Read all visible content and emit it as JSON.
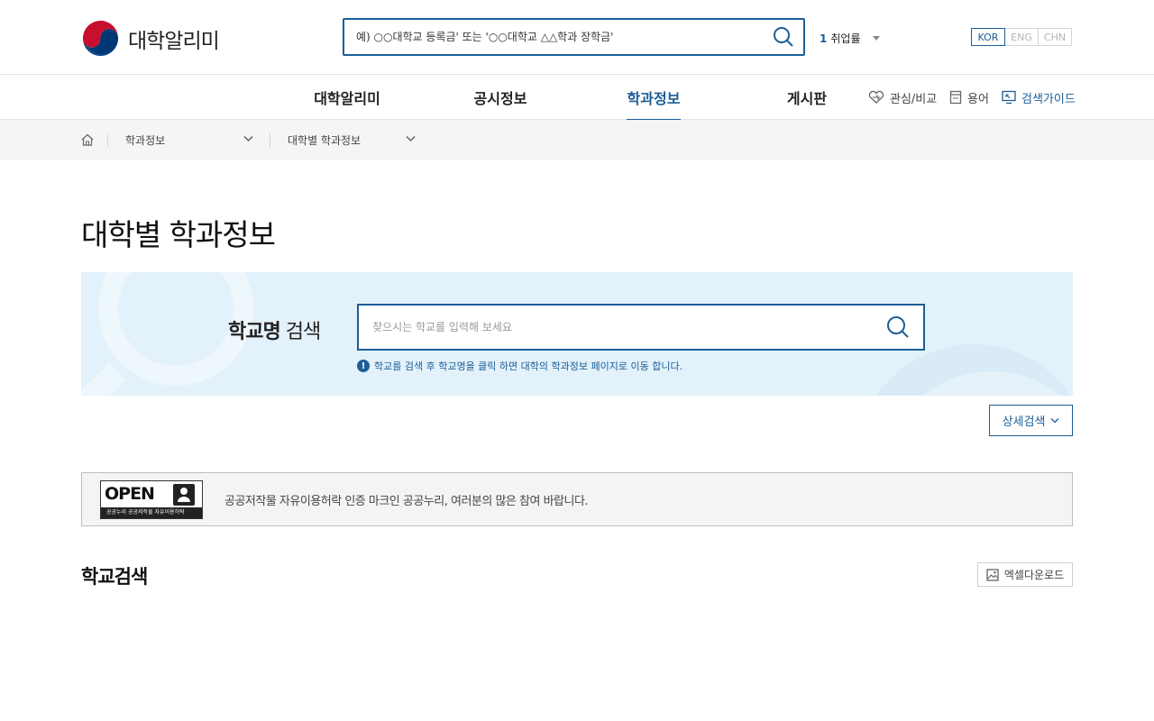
{
  "header": {
    "logo_text": "대학알리미",
    "search_placeholder": "예) ○○대학교 등록금' 또는 '○○대학교 △△학과 장학금'",
    "rank_number": "1",
    "rank_text": "취업률",
    "languages": [
      "KOR",
      "ENG",
      "CHN"
    ],
    "active_language": "KOR"
  },
  "gnb": {
    "items": [
      "대학알리미",
      "공시정보",
      "학과정보",
      "게시판"
    ],
    "active": "학과정보",
    "utils": {
      "favorites": "관심/비교",
      "glossary": "용어",
      "guide": "검색가이드"
    }
  },
  "breadcrumb": {
    "level1": "학과정보",
    "level2": "대학별 학과정보"
  },
  "page": {
    "title": "대학별 학과정보"
  },
  "search_panel": {
    "label_bold": "학교명",
    "label_rest": "검색",
    "placeholder": "찾으시는 학교를 입력해 보세요",
    "note": "학교를 검색 후 학교명을 클릭 하면 대학의 학과정보 페이지로 이동 합니다."
  },
  "detail_search": {
    "label": "상세검색"
  },
  "open_license": {
    "badge_word": "OPEN",
    "badge_strip": "공공누리  공공저작물 자유이용허락",
    "text": "공공저작물 자유이용허락 인증 마크인 공공누리, 여러분의 많은 참여 바랍니다."
  },
  "results": {
    "title": "학교검색",
    "excel_label": "엑셀다운로드"
  },
  "colors": {
    "accent": "#1b5e98",
    "panel_bg": "#e3f1fa",
    "crumb_bg": "#f5f5f5"
  }
}
